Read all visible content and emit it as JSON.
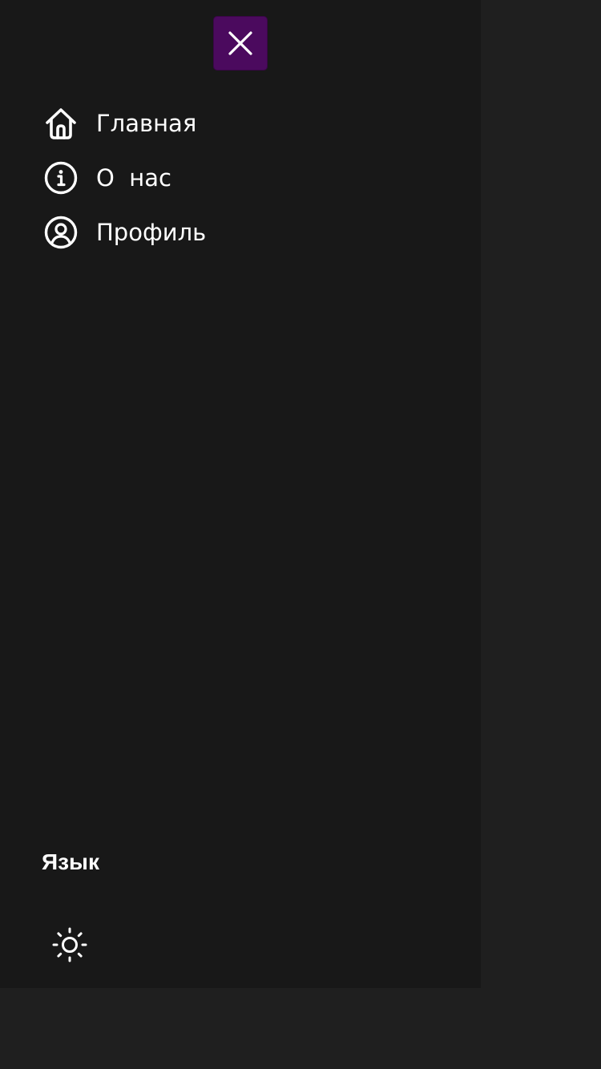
{
  "drawer": {
    "close_icon": "close-icon",
    "accent_color": "#4b0a5e",
    "nav": [
      {
        "icon": "home-icon",
        "label": "Главная"
      },
      {
        "icon": "info-icon",
        "label": "О  нас"
      },
      {
        "icon": "user-circle-icon",
        "label": "Профиль"
      }
    ],
    "language_title": "Язык",
    "theme_icon": "sun-icon"
  }
}
